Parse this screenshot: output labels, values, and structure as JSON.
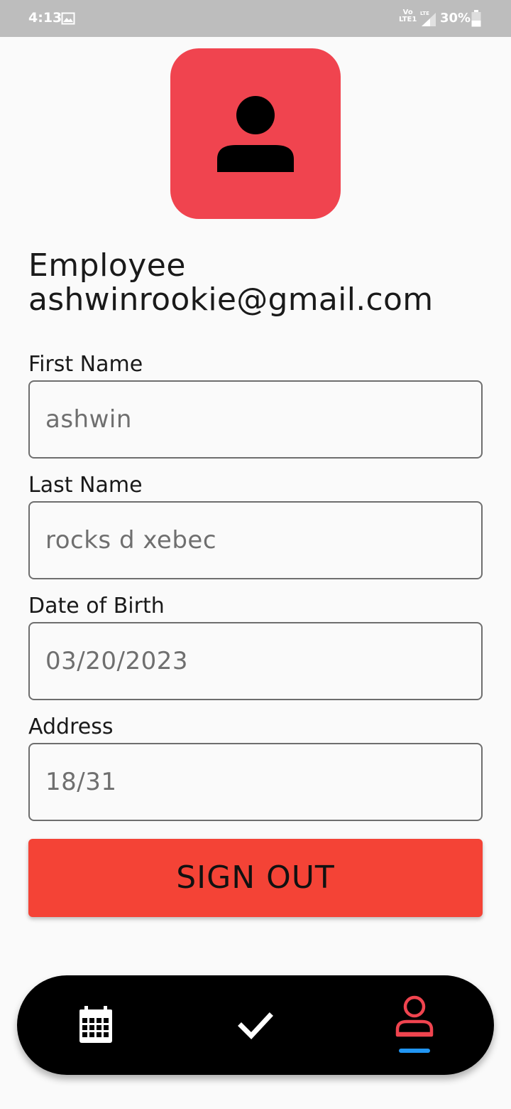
{
  "status_bar": {
    "time": "4:13",
    "network_top": "Vo",
    "network_bottom": "LTE1",
    "battery": "30%"
  },
  "profile": {
    "role": "Employee",
    "email": "ashwinrookie@gmail.com",
    "avatar_color": "#f0444f"
  },
  "fields": {
    "first_name": {
      "label": "First Name",
      "value": "ashwin"
    },
    "last_name": {
      "label": "Last Name",
      "value": "rocks d xebec"
    },
    "dob": {
      "label": "Date of Birth",
      "value": "03/20/2023"
    },
    "address": {
      "label": "Address",
      "value": "18/31"
    }
  },
  "signout": {
    "label": "SIGN OUT",
    "color": "#f44336"
  },
  "bottom_nav": {
    "items": [
      {
        "icon": "calendar-icon",
        "active": false
      },
      {
        "icon": "check-icon",
        "active": false
      },
      {
        "icon": "person-icon",
        "active": true
      }
    ],
    "active_color": "#f0444f",
    "indicator_color": "#2196f3"
  }
}
